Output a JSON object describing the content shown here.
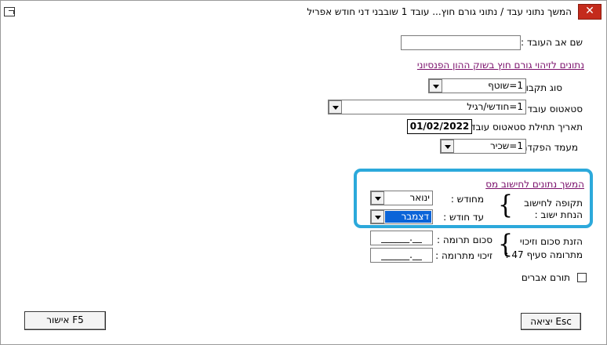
{
  "window": {
    "title": "המשך נתוני עבד / נתוני גורם חוץ...   עובד 1 שובבני דני   חודש אפריל",
    "close_label": "✕"
  },
  "form": {
    "father_name_label": "שם אב העובד :",
    "father_name_value": "",
    "pension_link": "נתונים לזיהוי גורם חוץ בשוק ההון הפנסיוני",
    "receipt_type_label": "סוג תקבול",
    "receipt_type_value": "1=שוטף",
    "employee_status_label": "סטאטוס עובד",
    "employee_status_value": "1=חודשי/רגיל",
    "status_start_label": "תאריך תחילת סטאטוס עובד",
    "status_start_value": "01/02/2022",
    "deposit_status_label": "מעמד הפקדה",
    "deposit_status_value": "1=שכיר"
  },
  "tax": {
    "link": "המשך נתונים לחישוב מס",
    "period_label_1": "תקופה לחישוב",
    "period_label_2": "הנחת ישוב :",
    "from_month_label": "מחודש :",
    "from_month_value": "ינואר",
    "to_month_label": "עד חודש :",
    "to_month_value": "דצמבר"
  },
  "donation": {
    "label_1": "הזנת סכום וזיכוי",
    "label_2": "מתרומה סעיף 47 :",
    "amount_label": "סכום תרומה :",
    "amount_value": "______.__",
    "credit_label": "זיכוי מתרומה :",
    "credit_value": "______.__"
  },
  "organ_donor": {
    "label": "תורם אברים",
    "checked": false
  },
  "buttons": {
    "exit": "יציאה Esc",
    "confirm": "אישור F5"
  }
}
